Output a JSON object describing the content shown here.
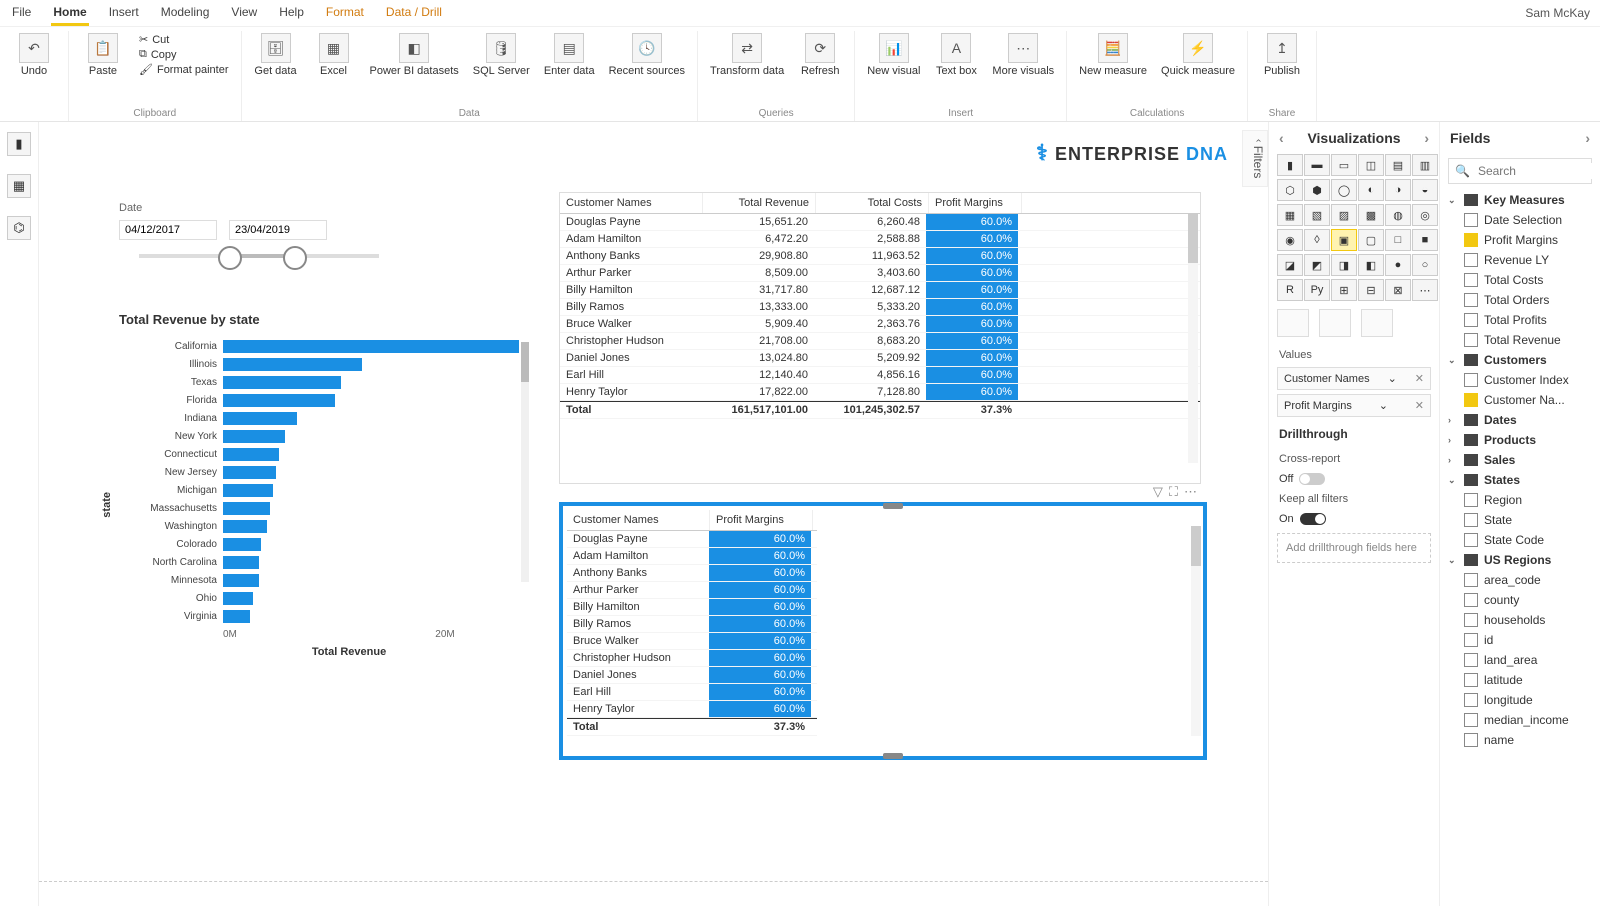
{
  "user": "Sam McKay",
  "menu": [
    "File",
    "Home",
    "Insert",
    "Modeling",
    "View",
    "Help",
    "Format",
    "Data / Drill"
  ],
  "clipboard": {
    "label": "Clipboard",
    "paste": "Paste",
    "cut": "Cut",
    "copy": "Copy",
    "format_painter": "Format painter",
    "undo": "Undo"
  },
  "data_group": {
    "label": "Data",
    "get_data": "Get data",
    "excel": "Excel",
    "pbi": "Power BI datasets",
    "sql": "SQL Server",
    "enter": "Enter data",
    "recent": "Recent sources"
  },
  "queries": {
    "label": "Queries",
    "transform": "Transform data",
    "refresh": "Refresh"
  },
  "insert": {
    "label": "Insert",
    "new_visual": "New visual",
    "text_box": "Text box",
    "more": "More visuals"
  },
  "calc": {
    "label": "Calculations",
    "new_measure": "New measure",
    "quick": "Quick measure"
  },
  "share": {
    "label": "Share",
    "publish": "Publish"
  },
  "filters_label": "Filters",
  "logo": {
    "text1": "ENTERPRISE ",
    "text2": "DNA"
  },
  "slicer": {
    "title": "Date",
    "from": "04/12/2017",
    "to": "23/04/2019"
  },
  "chart_data": {
    "type": "bar",
    "title": "Total Revenue by state",
    "ylabel": "state",
    "xlabel": "Total Revenue",
    "xticks": [
      "0M",
      "20M"
    ],
    "categories": [
      "California",
      "Illinois",
      "Texas",
      "Florida",
      "Indiana",
      "New York",
      "Connecticut",
      "New Jersey",
      "Michigan",
      "Massachusetts",
      "Washington",
      "Colorado",
      "North Carolina",
      "Minnesota",
      "Ohio",
      "Virginia"
    ],
    "values": [
      100,
      47,
      40,
      38,
      25,
      21,
      19,
      18,
      17,
      16,
      15,
      13,
      12,
      12,
      10,
      9
    ]
  },
  "table1": {
    "headers": [
      "Customer Names",
      "Total Revenue",
      "Total Costs",
      "Profit Margins"
    ],
    "rows": [
      {
        "name": "Douglas Payne",
        "rev": "15,651.20",
        "cost": "6,260.48",
        "pm": "60.0%"
      },
      {
        "name": "Adam Hamilton",
        "rev": "6,472.20",
        "cost": "2,588.88",
        "pm": "60.0%"
      },
      {
        "name": "Anthony Banks",
        "rev": "29,908.80",
        "cost": "11,963.52",
        "pm": "60.0%"
      },
      {
        "name": "Arthur Parker",
        "rev": "8,509.00",
        "cost": "3,403.60",
        "pm": "60.0%"
      },
      {
        "name": "Billy Hamilton",
        "rev": "31,717.80",
        "cost": "12,687.12",
        "pm": "60.0%"
      },
      {
        "name": "Billy Ramos",
        "rev": "13,333.00",
        "cost": "5,333.20",
        "pm": "60.0%"
      },
      {
        "name": "Bruce Walker",
        "rev": "5,909.40",
        "cost": "2,363.76",
        "pm": "60.0%"
      },
      {
        "name": "Christopher Hudson",
        "rev": "21,708.00",
        "cost": "8,683.20",
        "pm": "60.0%"
      },
      {
        "name": "Daniel Jones",
        "rev": "13,024.80",
        "cost": "5,209.92",
        "pm": "60.0%"
      },
      {
        "name": "Earl Hill",
        "rev": "12,140.40",
        "cost": "4,856.16",
        "pm": "60.0%"
      },
      {
        "name": "Henry Taylor",
        "rev": "17,822.00",
        "cost": "7,128.80",
        "pm": "60.0%"
      }
    ],
    "total": {
      "name": "Total",
      "rev": "161,517,101.00",
      "cost": "101,245,302.57",
      "pm": "37.3%"
    }
  },
  "table2": {
    "headers": [
      "Customer Names",
      "Profit Margins"
    ],
    "rows": [
      {
        "name": "Douglas Payne",
        "pm": "60.0%"
      },
      {
        "name": "Adam Hamilton",
        "pm": "60.0%"
      },
      {
        "name": "Anthony Banks",
        "pm": "60.0%"
      },
      {
        "name": "Arthur Parker",
        "pm": "60.0%"
      },
      {
        "name": "Billy Hamilton",
        "pm": "60.0%"
      },
      {
        "name": "Billy Ramos",
        "pm": "60.0%"
      },
      {
        "name": "Bruce Walker",
        "pm": "60.0%"
      },
      {
        "name": "Christopher Hudson",
        "pm": "60.0%"
      },
      {
        "name": "Daniel Jones",
        "pm": "60.0%"
      },
      {
        "name": "Earl Hill",
        "pm": "60.0%"
      },
      {
        "name": "Henry Taylor",
        "pm": "60.0%"
      }
    ],
    "total": {
      "name": "Total",
      "pm": "37.3%"
    }
  },
  "viz_panel": {
    "title": "Visualizations",
    "values_label": "Values",
    "wells": [
      "Customer Names",
      "Profit Margins"
    ],
    "drill_title": "Drillthrough",
    "cross": "Cross-report",
    "cross_state": "Off",
    "keep": "Keep all filters",
    "keep_state": "On",
    "drop": "Add drillthrough fields here"
  },
  "fields_panel": {
    "title": "Fields",
    "search_placeholder": "Search",
    "groups": [
      {
        "name": "Key Measures",
        "open": true,
        "items": [
          {
            "name": "Date Selection",
            "checked": false
          },
          {
            "name": "Profit Margins",
            "checked": true
          },
          {
            "name": "Revenue LY",
            "checked": false
          },
          {
            "name": "Total Costs",
            "checked": false
          },
          {
            "name": "Total Orders",
            "checked": false
          },
          {
            "name": "Total Profits",
            "checked": false
          },
          {
            "name": "Total Revenue",
            "checked": false
          }
        ]
      },
      {
        "name": "Customers",
        "open": true,
        "items": [
          {
            "name": "Customer Index",
            "checked": false
          },
          {
            "name": "Customer Na...",
            "checked": true
          }
        ]
      },
      {
        "name": "Dates",
        "open": false,
        "items": []
      },
      {
        "name": "Products",
        "open": false,
        "items": []
      },
      {
        "name": "Sales",
        "open": false,
        "items": []
      },
      {
        "name": "States",
        "open": true,
        "items": [
          {
            "name": "Region",
            "checked": false
          },
          {
            "name": "State",
            "checked": false
          },
          {
            "name": "State Code",
            "checked": false
          }
        ]
      },
      {
        "name": "US Regions",
        "open": true,
        "items": [
          {
            "name": "area_code",
            "checked": false
          },
          {
            "name": "county",
            "checked": false
          },
          {
            "name": "households",
            "checked": false
          },
          {
            "name": "id",
            "checked": false
          },
          {
            "name": "land_area",
            "checked": false
          },
          {
            "name": "latitude",
            "checked": false
          },
          {
            "name": "longitude",
            "checked": false
          },
          {
            "name": "median_income",
            "checked": false
          },
          {
            "name": "name",
            "checked": false
          }
        ]
      }
    ]
  }
}
